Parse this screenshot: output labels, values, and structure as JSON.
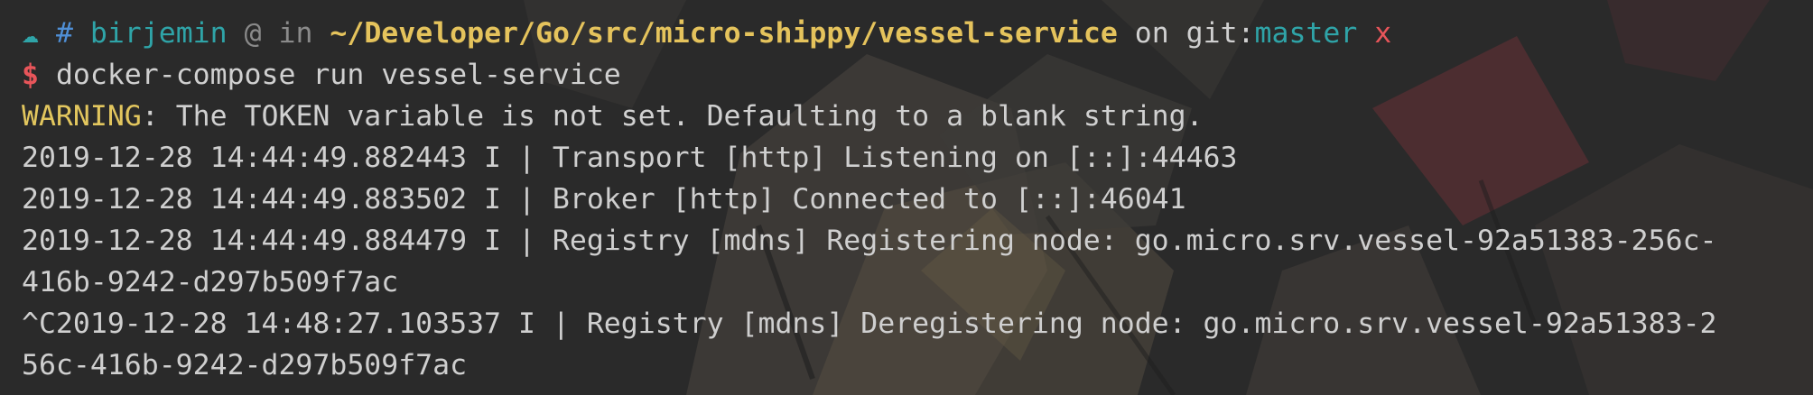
{
  "prompt": {
    "cloud": "☁",
    "hash": "#",
    "user": "birjemin",
    "at": "@",
    "in": "in",
    "path": "~/Developer/Go/src/micro-shippy/vessel-service",
    "on": "on",
    "git_label": "git:",
    "branch": "master",
    "dirty": "x"
  },
  "command": {
    "symbol": "$",
    "text": "docker-compose run vessel-service"
  },
  "output": {
    "warning_label": "WARNING",
    "warning_text": ": The TOKEN variable is not set. Defaulting to a blank string.",
    "lines": [
      "2019-12-28 14:44:49.882443 I | Transport [http] Listening on [::]:44463",
      "2019-12-28 14:44:49.883502 I | Broker [http] Connected to [::]:46041",
      "2019-12-28 14:44:49.884479 I | Registry [mdns] Registering node: go.micro.srv.vessel-92a51383-256c-",
      "416b-9242-d297b509f7ac",
      "^C2019-12-28 14:48:27.103537 I | Registry [mdns] Deregistering node: go.micro.srv.vessel-92a51383-2",
      "56c-416b-9242-d297b509f7ac"
    ]
  },
  "colors": {
    "background": "#2b2b2b",
    "text": "#cfcfcf",
    "blue": "#4f8fd6",
    "cyan": "#2fa4a8",
    "yellow": "#e5c35c",
    "red": "#e8555a"
  }
}
